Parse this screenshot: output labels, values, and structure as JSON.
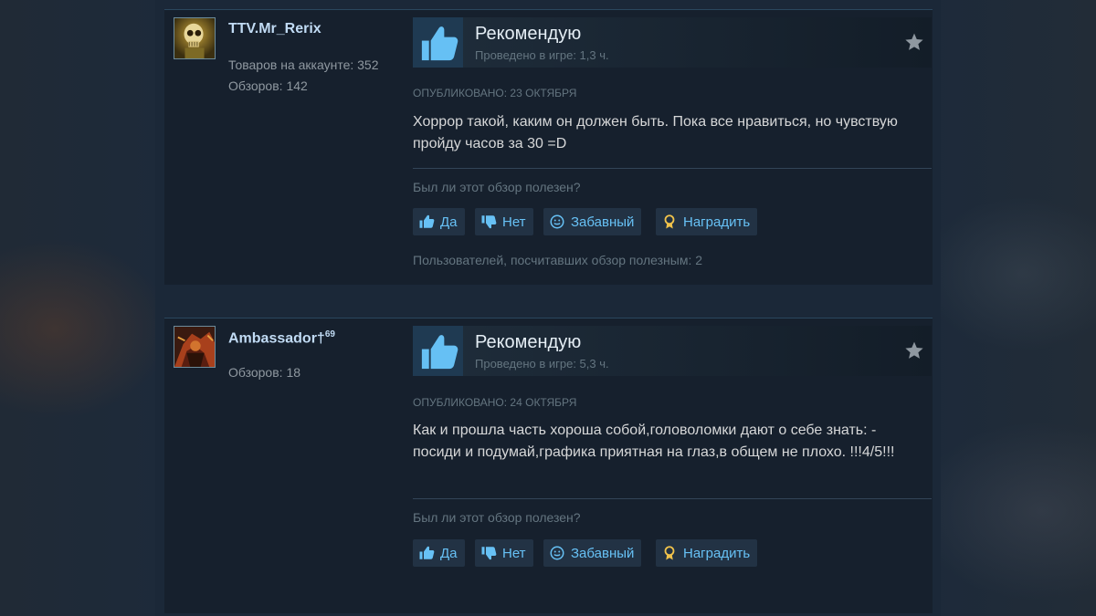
{
  "reviews": [
    {
      "author": {
        "name": "TTV.Mr_Rerix",
        "badge": "",
        "stats": [
          "Товаров на аккаунте: 352",
          "Обзоров: 142"
        ],
        "avatar_icon": "skull-avatar-icon"
      },
      "vote": {
        "title": "Рекомендую",
        "hours": "Проведено в игре: 1,3 ч."
      },
      "posted": "Опубликовано: 23 октября",
      "text": "Хоррор такой, каким он должен быть. Пока все нравиться, но чувствую пройду часов за 30 =D",
      "helpful_question": "Был ли этот обзор полезен?",
      "buttons": {
        "yes": "Да",
        "no": "Нет",
        "funny": "Забавный",
        "award": "Наградить"
      },
      "helpful_count": "Пользователей, посчитавших обзор полезным: 2"
    },
    {
      "author": {
        "name": "Ambassador†",
        "badge": "69",
        "stats": [
          "Обзоров: 18"
        ],
        "avatar_icon": "character-avatar-icon"
      },
      "vote": {
        "title": "Рекомендую",
        "hours": "Проведено в игре: 5,3 ч."
      },
      "posted": "Опубликовано: 24 октября",
      "text": "Как и прошла часть хороша собой,головоломки дают о себе знать: - посиди и подумай,графика приятная на глаз,в общем не плохо. !!!4/5!!!",
      "helpful_question": "Был ли этот обзор полезен?",
      "buttons": {
        "yes": "Да",
        "no": "Нет",
        "funny": "Забавный",
        "award": "Наградить"
      }
    }
  ],
  "colors": {
    "accent": "#67c1f5",
    "background": "#1b2838",
    "panel": "#16202d",
    "button": "#223244",
    "award": "#f1c34b"
  }
}
